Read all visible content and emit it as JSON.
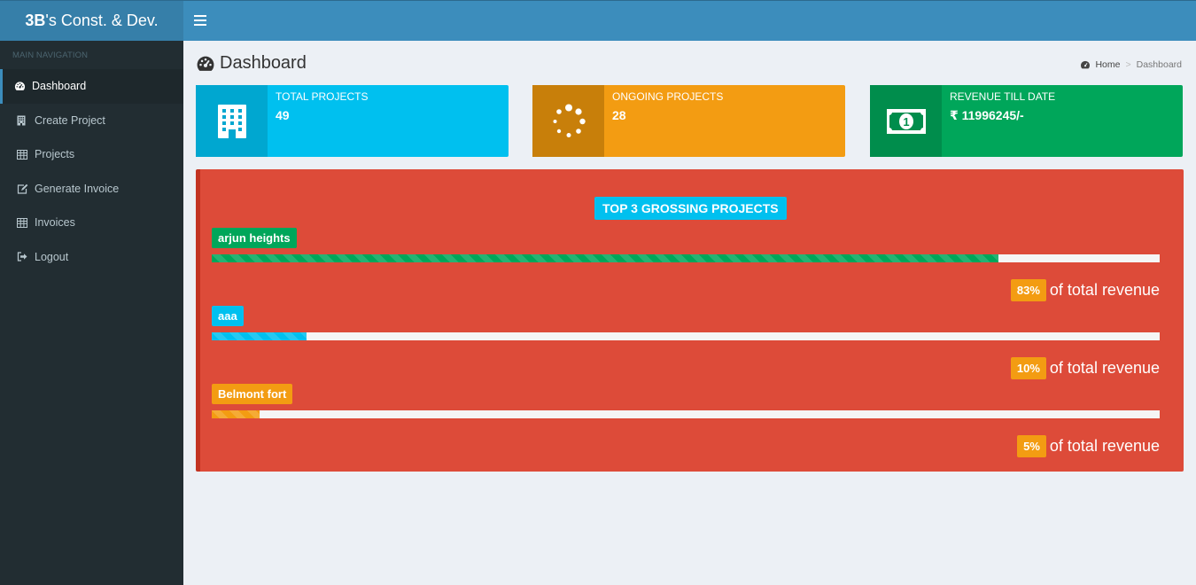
{
  "brand": {
    "bold": "3B",
    "rest": "'s Const. & Dev."
  },
  "sidebar": {
    "header": "MAIN NAVIGATION",
    "items": [
      {
        "label": "Dashboard",
        "icon": "dashboard-icon",
        "active": true
      },
      {
        "label": "Create Project",
        "icon": "building-icon"
      },
      {
        "label": "Projects",
        "icon": "table-icon"
      },
      {
        "label": "Generate Invoice",
        "icon": "edit-icon"
      },
      {
        "label": "Invoices",
        "icon": "table-icon"
      },
      {
        "label": "Logout",
        "icon": "sign-out-icon"
      }
    ]
  },
  "page": {
    "title": "Dashboard"
  },
  "breadcrumb": {
    "home": "Home",
    "current": "Dashboard"
  },
  "info_boxes": [
    {
      "label": "TOTAL PROJECTS",
      "value": "49",
      "color": "#00c0ef",
      "icon": "building-icon"
    },
    {
      "label": "ONGOING PROJECTS",
      "value": "28",
      "color": "#f39c12",
      "icon": "spinner-icon"
    },
    {
      "label": "REVENUE TILL DATE",
      "value": "₹ 11996245/-",
      "color": "#00a65a",
      "icon": "money-icon"
    }
  ],
  "top_projects": {
    "title": "TOP 3 GROSSING PROJECTS",
    "suffix": "of total revenue",
    "items": [
      {
        "name": "arjun heights",
        "percent_label": "83%",
        "percent": 83,
        "color": "#00a65a"
      },
      {
        "name": "aaa",
        "percent_label": "10%",
        "percent": 10,
        "color": "#00c0ef"
      },
      {
        "name": "Belmont fort",
        "percent_label": "5%",
        "percent": 5,
        "color": "#f39c12"
      }
    ]
  },
  "colors": {
    "accent": "#3c8dbc",
    "sidebar": "#222d32",
    "panel": "#dd4b39"
  }
}
